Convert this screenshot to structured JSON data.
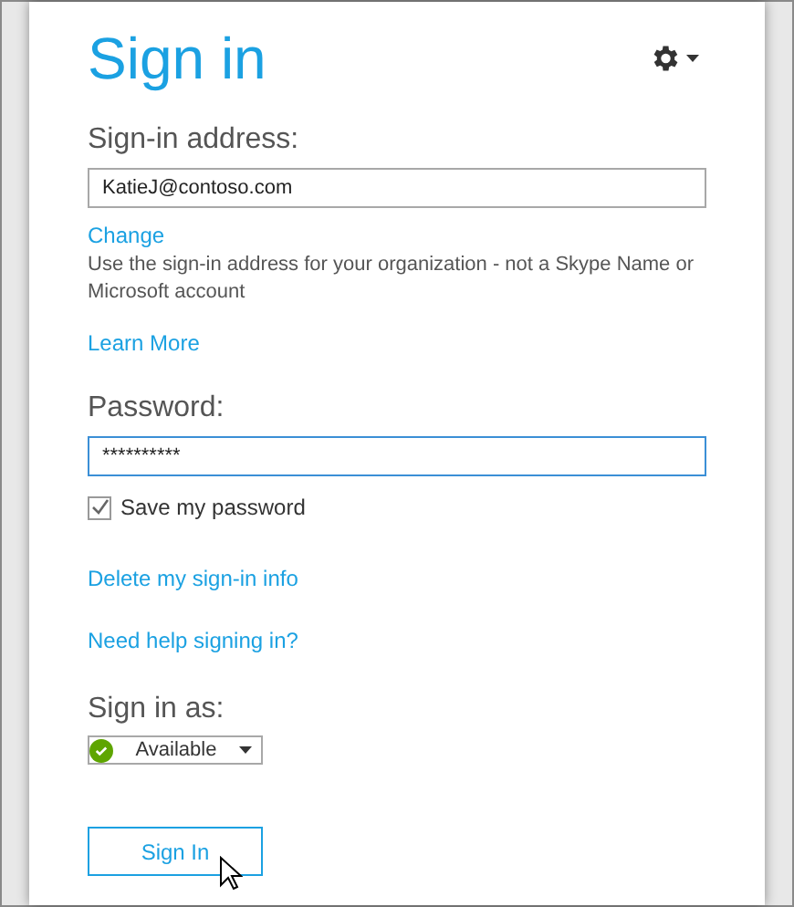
{
  "title": "Sign in",
  "address": {
    "label": "Sign-in address:",
    "value": "KatieJ@contoso.com"
  },
  "change_link": "Change",
  "description": "Use the sign-in address for your organization - not a Skype Name or Microsoft account",
  "learn_more_link": "Learn More",
  "password": {
    "label": "Password:",
    "value": "**********"
  },
  "save_password": {
    "label": "Save my password",
    "checked": true
  },
  "delete_link": "Delete my sign-in info",
  "help_link": "Need help signing in?",
  "sign_in_as": {
    "label": "Sign in as:",
    "status": "Available",
    "color": "#5ea500"
  },
  "sign_in_button": "Sign In"
}
